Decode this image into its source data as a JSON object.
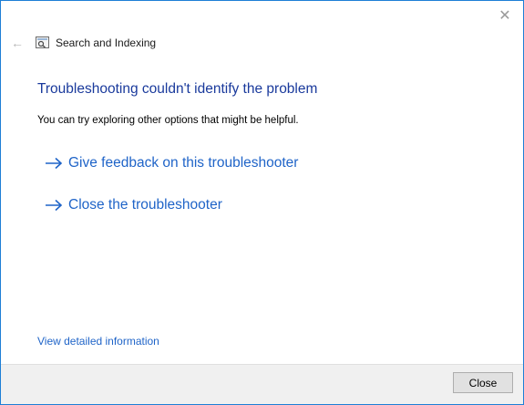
{
  "window": {
    "close_glyph": "✕"
  },
  "header": {
    "back_glyph": "←",
    "icon": "search-indexing-icon",
    "title": "Search and Indexing"
  },
  "main": {
    "heading": "Troubleshooting couldn't identify the problem",
    "subtext": "You can try exploring other options that might be helpful.",
    "links": [
      {
        "label": "Give feedback on this troubleshooter",
        "icon": "arrow-right-icon"
      },
      {
        "label": "Close the troubleshooter",
        "icon": "arrow-right-icon"
      }
    ],
    "details_link": "View detailed information"
  },
  "footer": {
    "close_label": "Close"
  },
  "colors": {
    "accent": "#1e7fd6",
    "heading": "#1a3a9c",
    "link": "#1f64c8"
  }
}
